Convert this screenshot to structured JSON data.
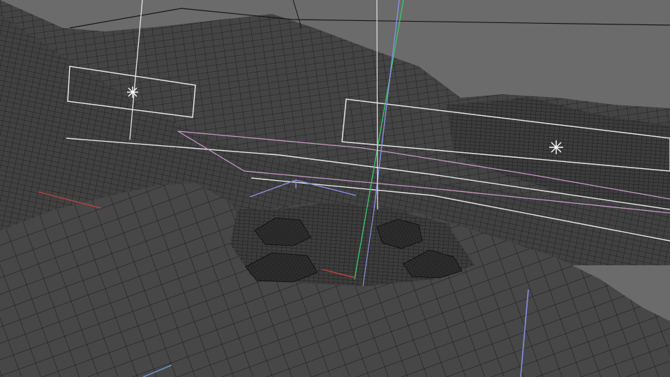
{
  "viewport": {
    "view_mode": "wireframe",
    "colors": {
      "background": "#6b6b6b",
      "terrain_fill": "#454545",
      "terrain_fill_dark": "#3a3a3a",
      "wire": "#1a1a1a",
      "selection_outline": "#e8e8e8",
      "axis_green": "#37c56a",
      "axis_blue": "#8a8ee6",
      "axis_red": "#b84040",
      "highlight_pink": "#c79ac7"
    },
    "objects": [
      {
        "name": "light-marker-left",
        "icon": "light-star-icon"
      },
      {
        "name": "light-marker-right",
        "icon": "light-star-icon"
      },
      {
        "name": "vertical-axis-gizmo",
        "icon": "axis-lines-icon"
      },
      {
        "name": "crater-rocks",
        "icon": "rock-mesh-icon"
      }
    ]
  }
}
